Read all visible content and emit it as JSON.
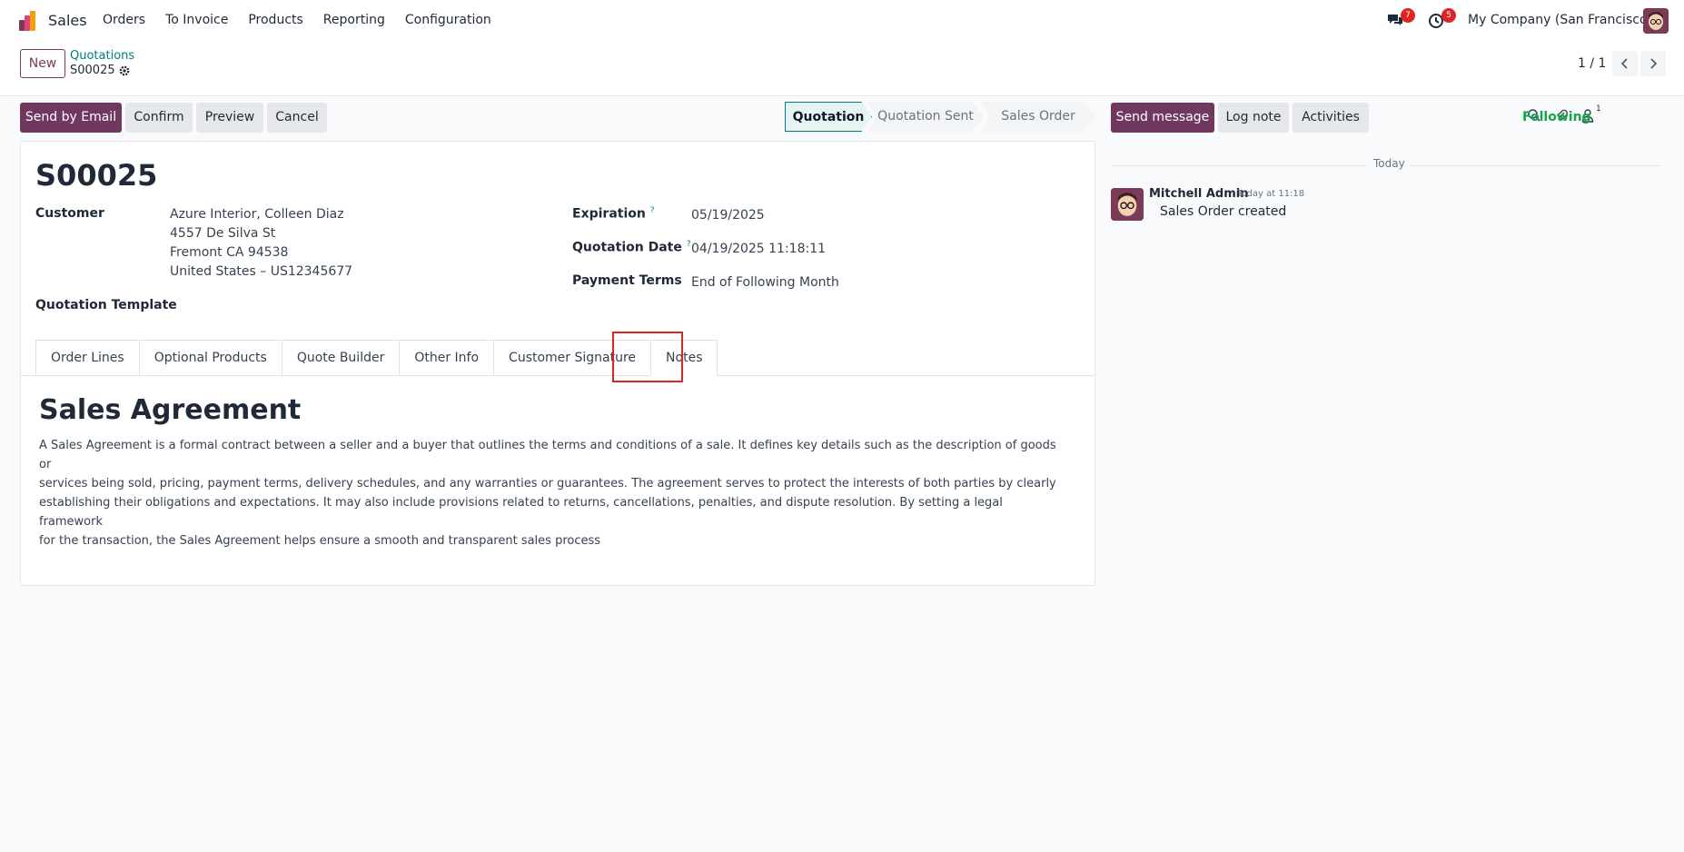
{
  "topbar": {
    "app_name": "Sales",
    "menu": [
      "Orders",
      "To Invoice",
      "Products",
      "Reporting",
      "Configuration"
    ],
    "messages_badge": "7",
    "activities_badge": "5",
    "company": "My Company (San Francisco)"
  },
  "control": {
    "new_label": "New",
    "breadcrumb_parent": "Quotations",
    "breadcrumb_current": "S00025",
    "pager": "1 / 1"
  },
  "actions": {
    "send_email": "Send by Email",
    "confirm": "Confirm",
    "preview": "Preview",
    "cancel": "Cancel"
  },
  "statusbar": {
    "steps": [
      "Quotation",
      "Quotation Sent",
      "Sales Order"
    ],
    "active": "Quotation"
  },
  "form": {
    "name": "S00025",
    "customer_label": "Customer",
    "customer_name": "Azure Interior, Colleen Diaz",
    "customer_address": [
      "4557 De Silva St",
      "Fremont CA 94538",
      "United States – US12345677"
    ],
    "template_label": "Quotation Template",
    "expiration_label": "Expiration",
    "expiration_value": "05/19/2025",
    "quotation_date_label": "Quotation Date",
    "quotation_date_value": "04/19/2025 11:18:11",
    "payment_terms_label": "Payment Terms",
    "payment_terms_value": "End of Following Month",
    "help_mark": "?"
  },
  "tabs": [
    "Order Lines",
    "Optional Products",
    "Quote Builder",
    "Other Info",
    "Customer Signature",
    "Notes"
  ],
  "active_tab": "Notes",
  "notes": {
    "title": "Sales Agreement",
    "lines": [
      "A Sales Agreement is a formal contract between a seller and a buyer that outlines the terms and conditions of a sale. It defines key details such as the description of goods or",
      "services being sold, pricing, payment terms, delivery schedules, and any warranties or guarantees. The agreement serves to protect the interests of both parties by clearly",
      "establishing their obligations and expectations. It may also include provisions related to returns, cancellations, penalties, and dispute resolution. By setting a legal framework",
      "for the transaction, the Sales Agreement helps ensure a smooth and transparent sales process"
    ]
  },
  "chatter": {
    "send_message": "Send message",
    "log_note": "Log note",
    "activities": "Activities",
    "followers_count": "1",
    "following": "Following",
    "date_separator": "Today",
    "message": {
      "author": "Mitchell Admin",
      "time": "Today at 11:18",
      "body": "Sales Order created"
    }
  },
  "colors": {
    "primary": "#71385f",
    "accent": "#017e84",
    "following": "#16a34a",
    "badge": "#dc2626",
    "highlight": "#dc2626"
  }
}
